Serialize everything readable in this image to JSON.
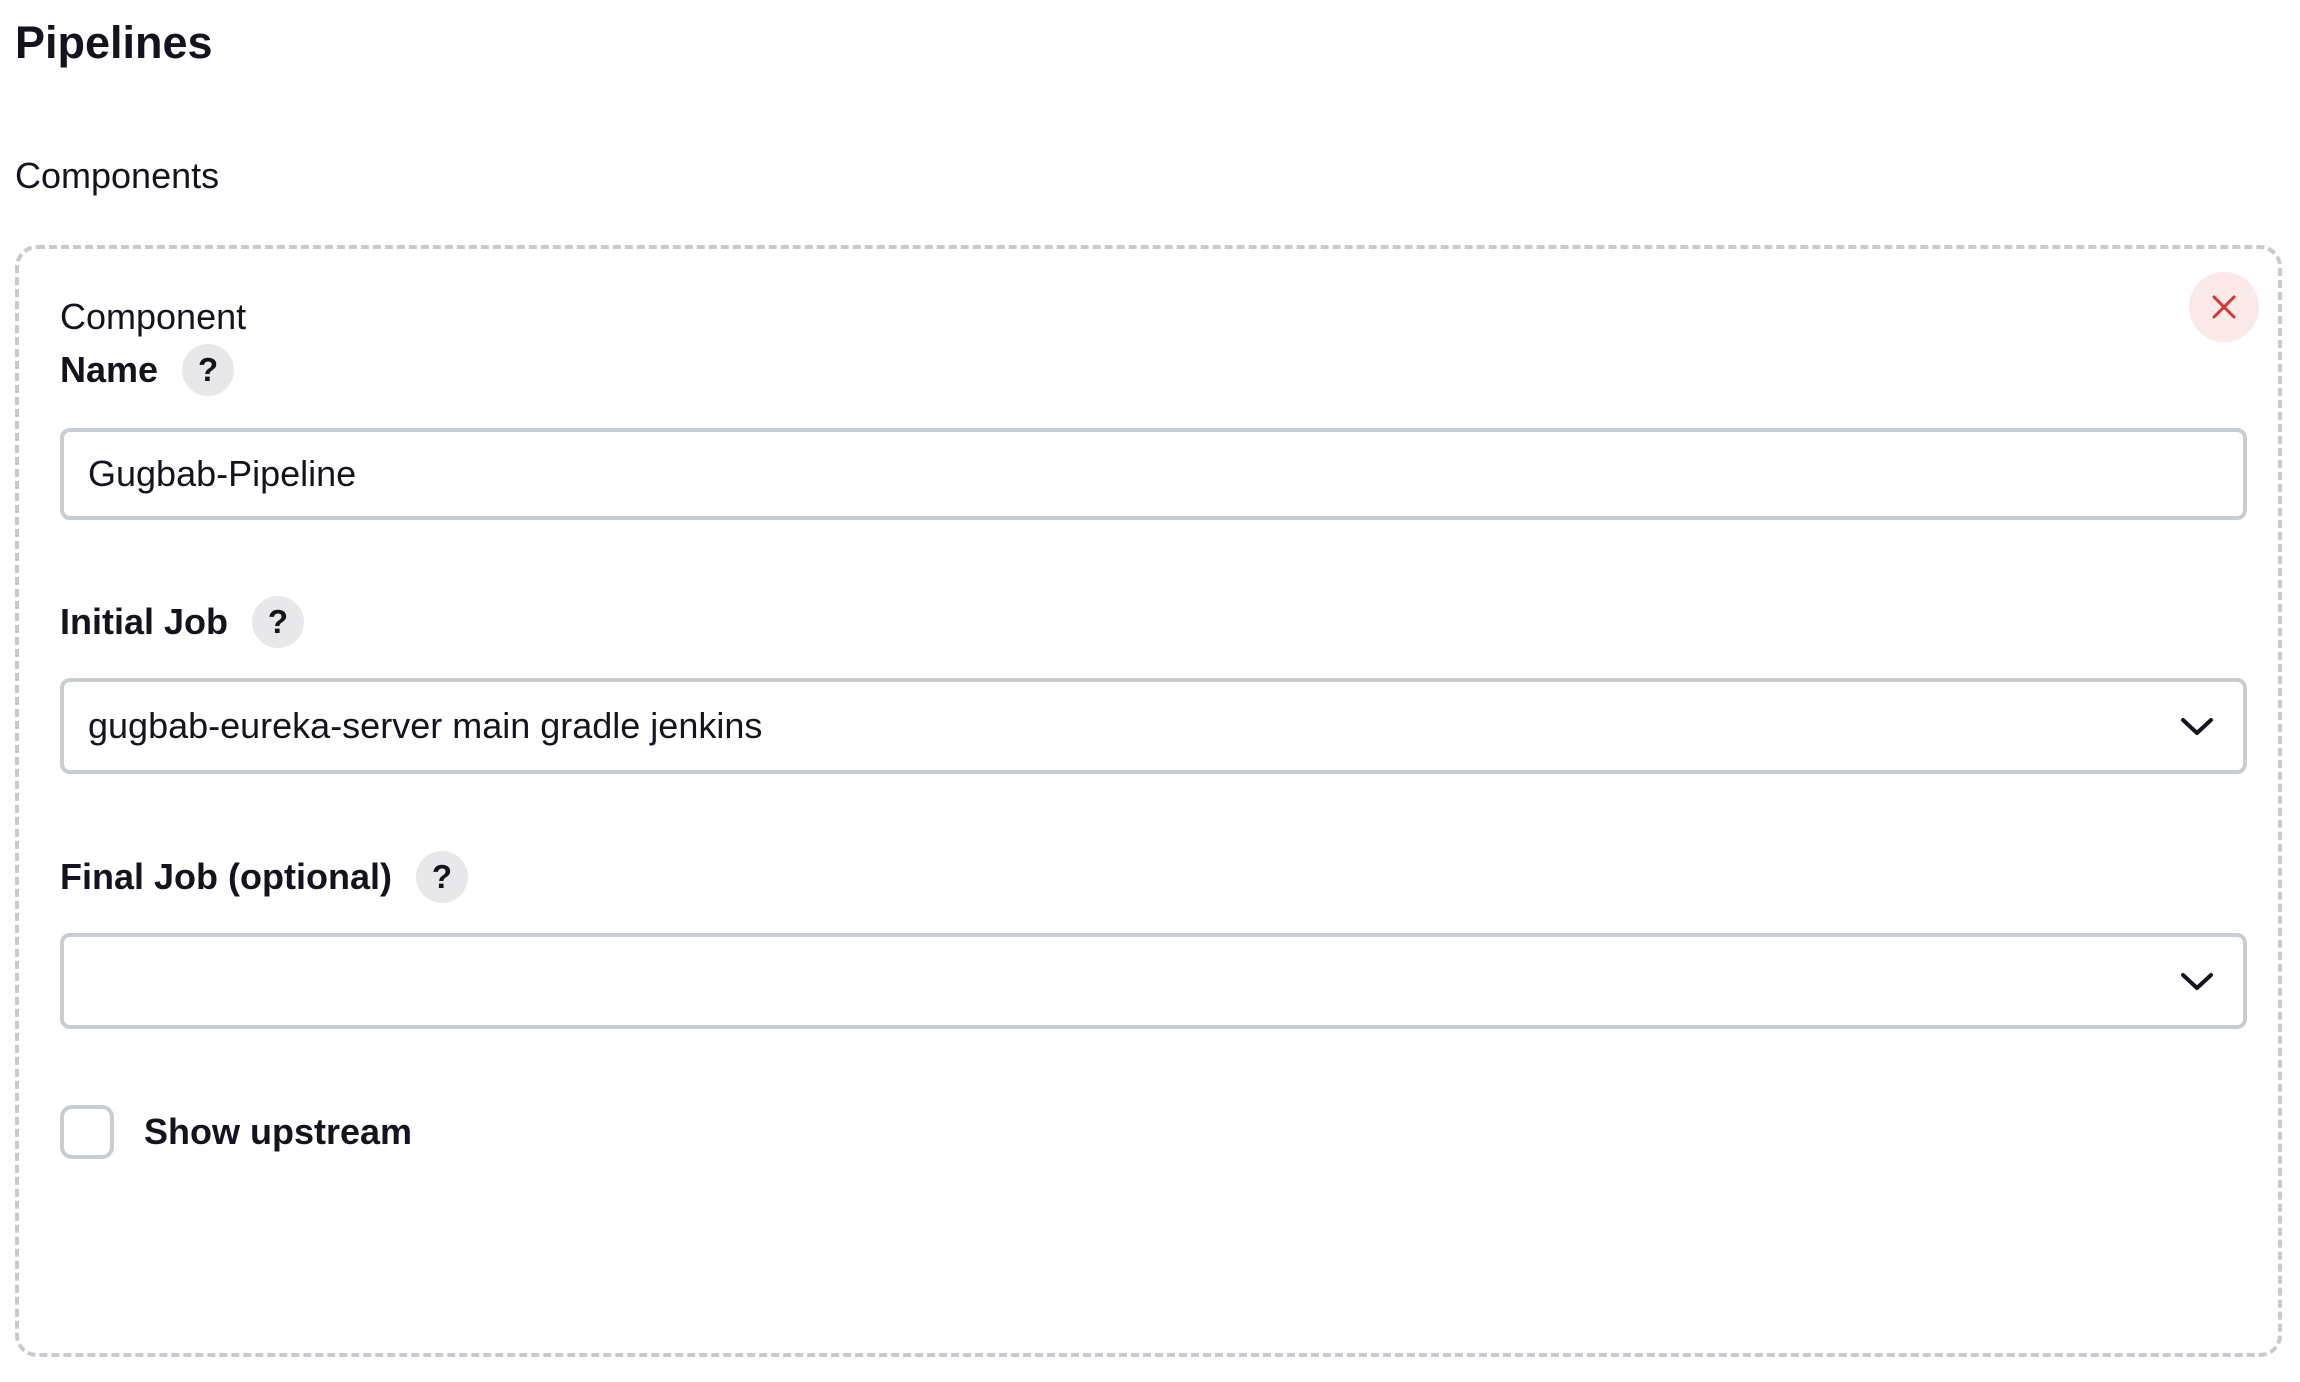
{
  "page": {
    "title": "Pipelines"
  },
  "section": {
    "label": "Components"
  },
  "component": {
    "heading": "Component",
    "close_icon": "close-icon",
    "name": {
      "label": "Name",
      "help": "?",
      "value": "Gugbab-Pipeline"
    },
    "initial_job": {
      "label": "Initial Job",
      "help": "?",
      "value": "gugbab-eureka-server main gradle jenkins"
    },
    "final_job": {
      "label": "Final Job (optional)",
      "help": "?",
      "value": ""
    },
    "show_upstream": {
      "label": "Show upstream",
      "checked": false
    }
  },
  "colors": {
    "text": "#14141f",
    "border": "#c7cdd1",
    "close_bg": "#fbe9ea",
    "close_icon": "#d33833",
    "help_bg": "#e8e8ea"
  }
}
